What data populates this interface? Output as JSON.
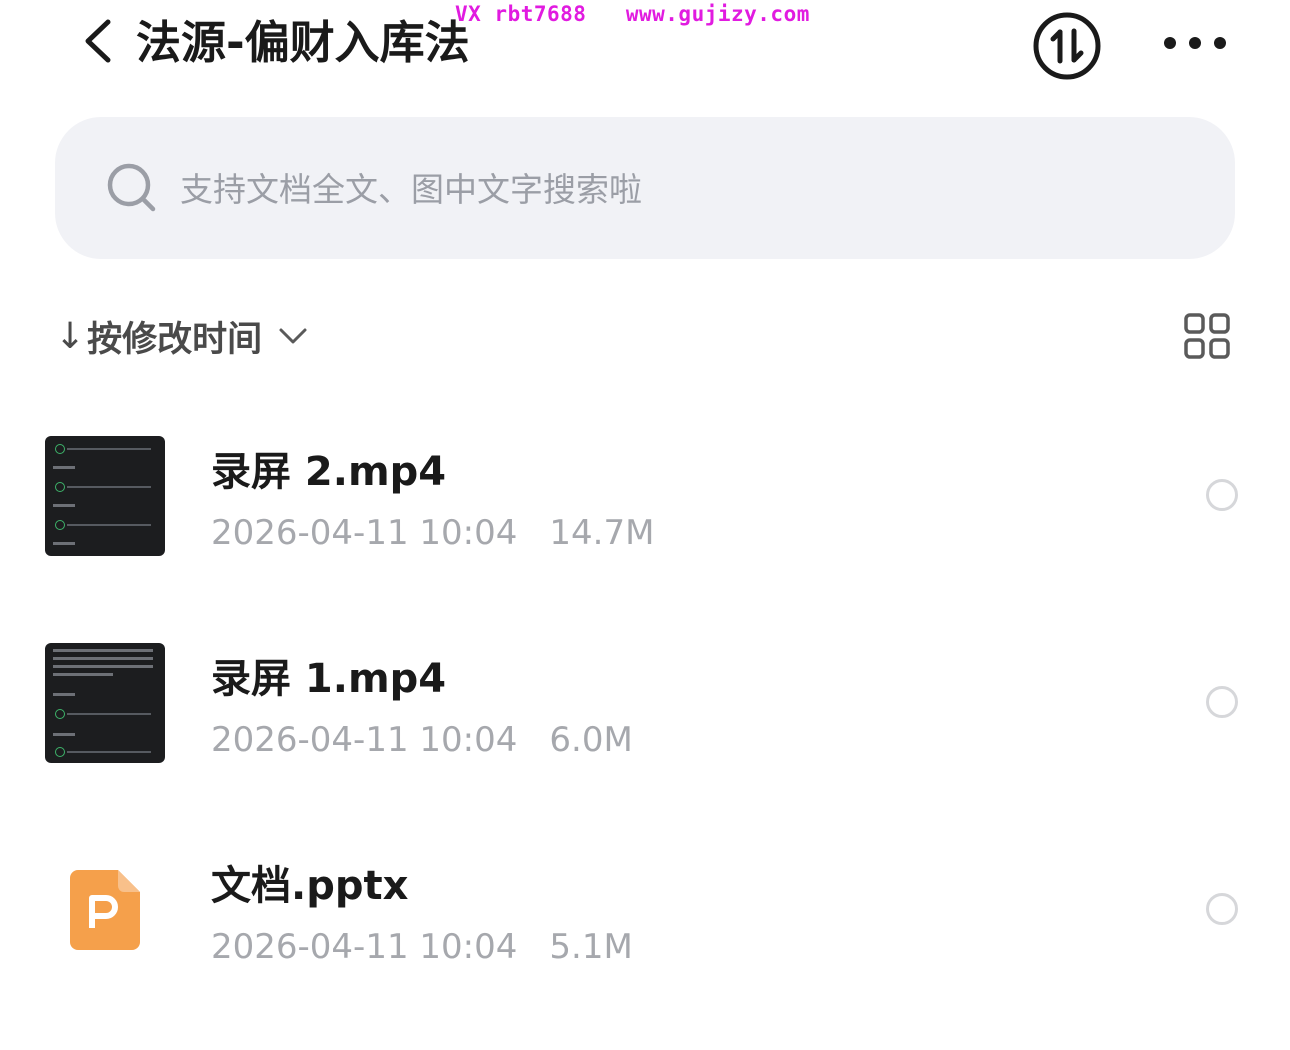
{
  "watermark": "VX rbt7688   www.gujizy.com",
  "header": {
    "title": "法源-偏财入库法",
    "back_icon": "chevron-left-icon",
    "transfer_icon": "transfer-circle-icon",
    "more_icon": "more-horizontal-icon"
  },
  "search": {
    "placeholder": "支持文档全文、图中文字搜索啦",
    "value": "",
    "icon": "search-icon"
  },
  "sort": {
    "arrow": "↓",
    "label": "按修改时间",
    "chevron_icon": "chevron-down-icon",
    "view_toggle_icon": "grid-view-icon"
  },
  "files": [
    {
      "name": "录屏 2.mp4",
      "date": "2026-04-11 10:04",
      "size": "14.7M",
      "type": "video"
    },
    {
      "name": "录屏 1.mp4",
      "date": "2026-04-11 10:04",
      "size": "6.0M",
      "type": "video"
    },
    {
      "name": "文档.pptx",
      "date": "2026-04-11 10:04",
      "size": "5.1M",
      "type": "pptx"
    }
  ],
  "colors": {
    "watermark": "#e11be0",
    "search_bg": "#f1f2f6",
    "meta_text": "#a6a8ad",
    "ppt_orange": "#f5a04b"
  }
}
